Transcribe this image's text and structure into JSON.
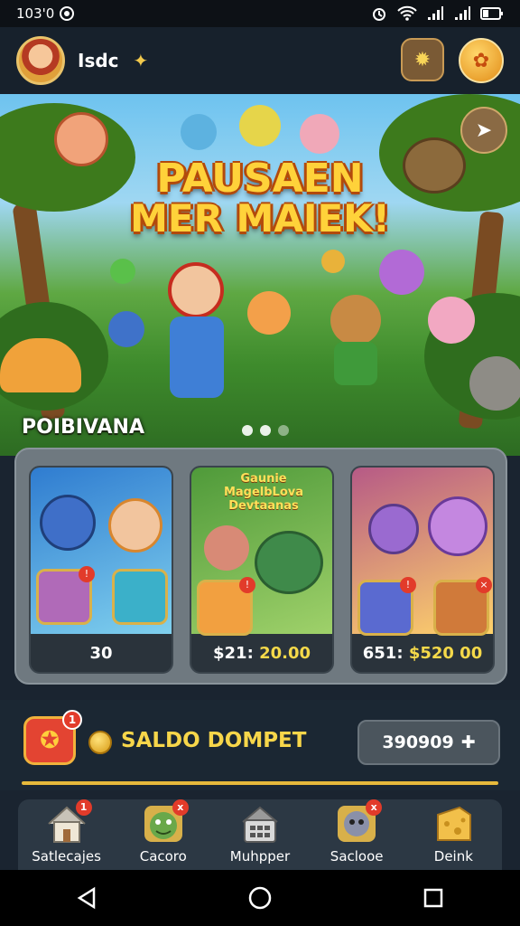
{
  "status_bar": {
    "time": "103'0",
    "app_icon": "circle-dot-icon",
    "icons": [
      "alarm-icon",
      "wifi-icon",
      "signal-icon",
      "signal-icon",
      "battery-icon"
    ]
  },
  "topbar": {
    "username": "Isdc",
    "profile_icon": "avatar",
    "settings_icon": "gear-icon",
    "reward_icon": "badge-icon"
  },
  "hero": {
    "title_line1": "PAUSAEN",
    "title_line2": "MER MAIEK!",
    "label": "POIBIVANA",
    "page_dots": 3,
    "active_dot": 0,
    "corner_icon": "pointer-icon"
  },
  "cards": [
    {
      "title": "",
      "price_prefix": "",
      "price_value": "30",
      "colors": [
        "#2f7cd0",
        "#7fd0ee"
      ]
    },
    {
      "title": "Gaunie\nMagelbLova\nDevtaanas",
      "price_prefix": "$21:",
      "price_value": "20.00",
      "colors": [
        "#4f9a3a",
        "#9fd16a"
      ]
    },
    {
      "title": "",
      "price_prefix": "651:",
      "price_value": "$520 00",
      "colors": [
        "#b65a86",
        "#ffd36a"
      ]
    }
  ],
  "wallet": {
    "label": "SALDO DOMPET",
    "amount": "390909",
    "badge": "1",
    "add_icon": "plus-icon"
  },
  "bottom_nav": [
    {
      "label": "Satlecajes",
      "icon": "home-icon",
      "badge": "1"
    },
    {
      "label": "Cacoro",
      "icon": "monster-icon",
      "badge": "x"
    },
    {
      "label": "Muhpper",
      "icon": "shop-icon",
      "badge": ""
    },
    {
      "label": "Saclooe",
      "icon": "ghost-icon",
      "badge": "x"
    },
    {
      "label": "Deink",
      "icon": "cheese-icon",
      "badge": ""
    }
  ],
  "colors": {
    "accent": "#f7d64a",
    "badge": "#e23b2a",
    "panel": "#2c3844"
  }
}
